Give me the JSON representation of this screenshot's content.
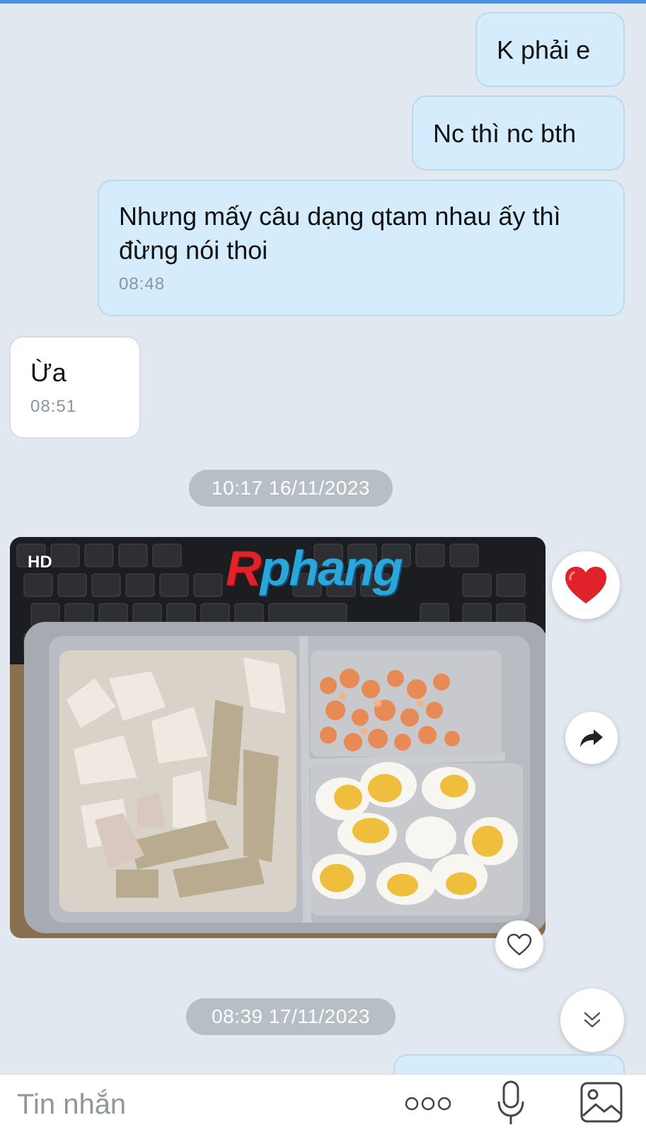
{
  "messages": [
    {
      "text": "K phải e"
    },
    {
      "text": "Nc thì nc bth"
    },
    {
      "text": "Nhưng mấy câu dạng qtam nhau ấy thì đừng nói thoi",
      "time": "08:48"
    },
    {
      "text": "Ừa",
      "time": "08:51"
    }
  ],
  "dates": [
    "10:17 16/11/2023",
    "08:39 17/11/2023"
  ],
  "photo": {
    "hd_badge": "HD",
    "watermark": "Rphang",
    "watermark_first": "R",
    "watermark_rest": "phang"
  },
  "composer": {
    "placeholder": "Tin nhắn"
  },
  "icons": {
    "reaction": "heart-icon",
    "share": "share-arrow-icon",
    "like": "heart-outline-icon",
    "scroll": "double-chevron-down-icon",
    "more": "more-dots-icon",
    "mic": "microphone-icon",
    "image": "image-icon"
  },
  "colors": {
    "background": "#e2e8f0",
    "outgoing_bubble": "#d5ecfc",
    "incoming_bubble": "#ffffff",
    "date_pill": "#b6bec6",
    "heart": "#e0232b"
  }
}
